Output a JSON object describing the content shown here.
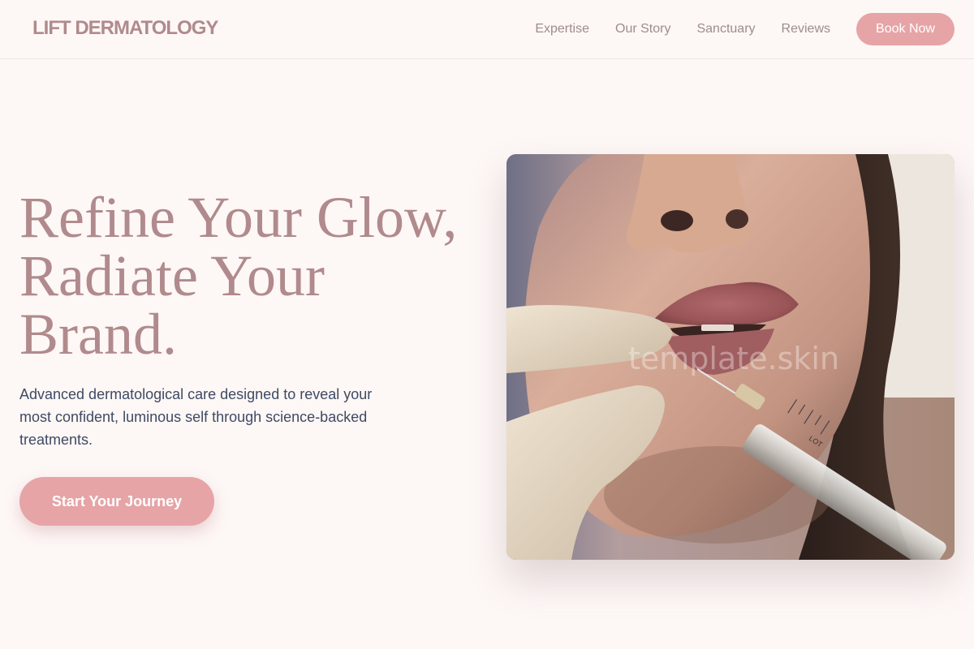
{
  "header": {
    "logo": "LIFT DERMATOLOGY",
    "nav": [
      "Expertise",
      "Our Story",
      "Sanctuary",
      "Reviews"
    ],
    "book_label": "Book Now"
  },
  "hero": {
    "title_lines": [
      "Refine Your Glow,",
      "Radiate Your",
      "Brand."
    ],
    "subtitle": "Advanced dermatological care designed to reveal your most confident, luminous self through science-backed treatments.",
    "cta_label": "Start Your Journey"
  },
  "image": {
    "description_icon": "photo-lip-injection",
    "watermark": "template.skin",
    "syringe_label": "LOT"
  },
  "colors": {
    "background": "#fdf7f6",
    "brand": "#b08a8c",
    "accent": "#e6a4a6",
    "body_text": "#3e4a63",
    "nav_text": "#a08c8e"
  }
}
